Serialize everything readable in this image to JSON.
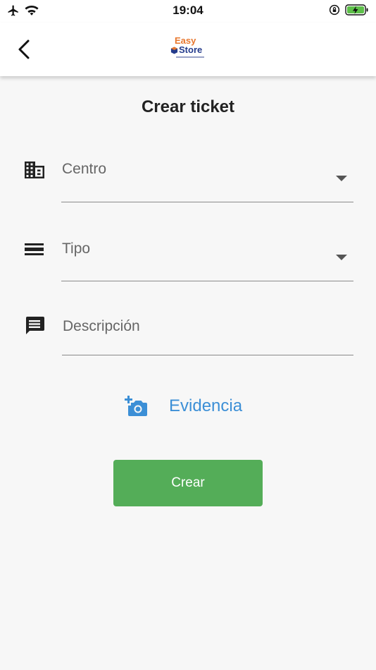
{
  "status_bar": {
    "time": "19:04",
    "icons": [
      "airplane-icon",
      "wifi-icon",
      "rotation-lock-icon",
      "battery-charging-icon"
    ]
  },
  "app_bar": {
    "back_icon": "chevron-left-icon",
    "logo": {
      "line1": "Easy",
      "line2": "Store"
    }
  },
  "page": {
    "title": "Crear ticket"
  },
  "form": {
    "centro": {
      "label": "Centro",
      "icon": "building-icon"
    },
    "tipo": {
      "label": "Tipo",
      "icon": "list-lines-icon"
    },
    "descripcion": {
      "label": "Descripción",
      "icon": "message-icon"
    },
    "evidence": {
      "label": "Evidencia",
      "icon": "add-camera-icon"
    },
    "submit_label": "Crear"
  },
  "colors": {
    "accent_blue": "#3c8fd6",
    "button_green": "#54ad58",
    "logo_orange": "#e8772e",
    "logo_navy": "#243b8c",
    "background": "#f7f7f7"
  }
}
